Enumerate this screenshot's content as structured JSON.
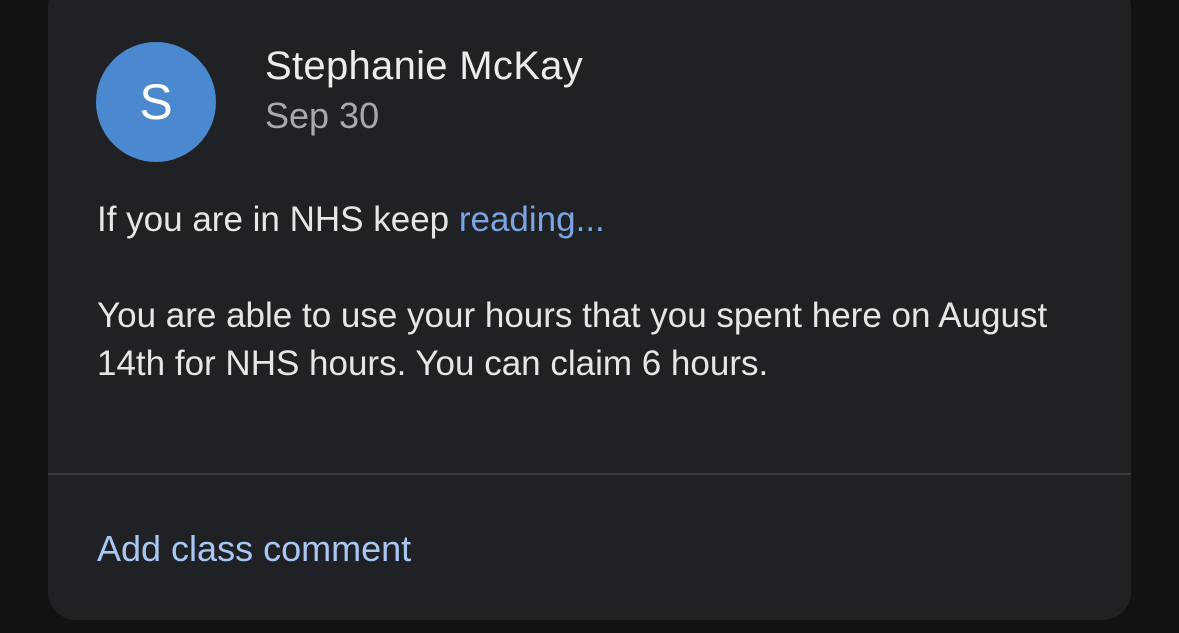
{
  "post": {
    "avatar_letter": "S",
    "author": "Stephanie McKay",
    "date": "Sep 30",
    "intro_text": "If you are in NHS keep ",
    "intro_link": "reading...",
    "body_text": "You are able to use your hours that you spent here on August 14th for NHS hours. You can claim 6 hours."
  },
  "actions": {
    "add_comment_label": "Add class comment"
  },
  "colors": {
    "avatar_bg": "#4a89d0",
    "link": "#7aa4e4",
    "comment_link": "#a9c6f5",
    "card_bg": "#202124",
    "page_bg": "#121214"
  }
}
